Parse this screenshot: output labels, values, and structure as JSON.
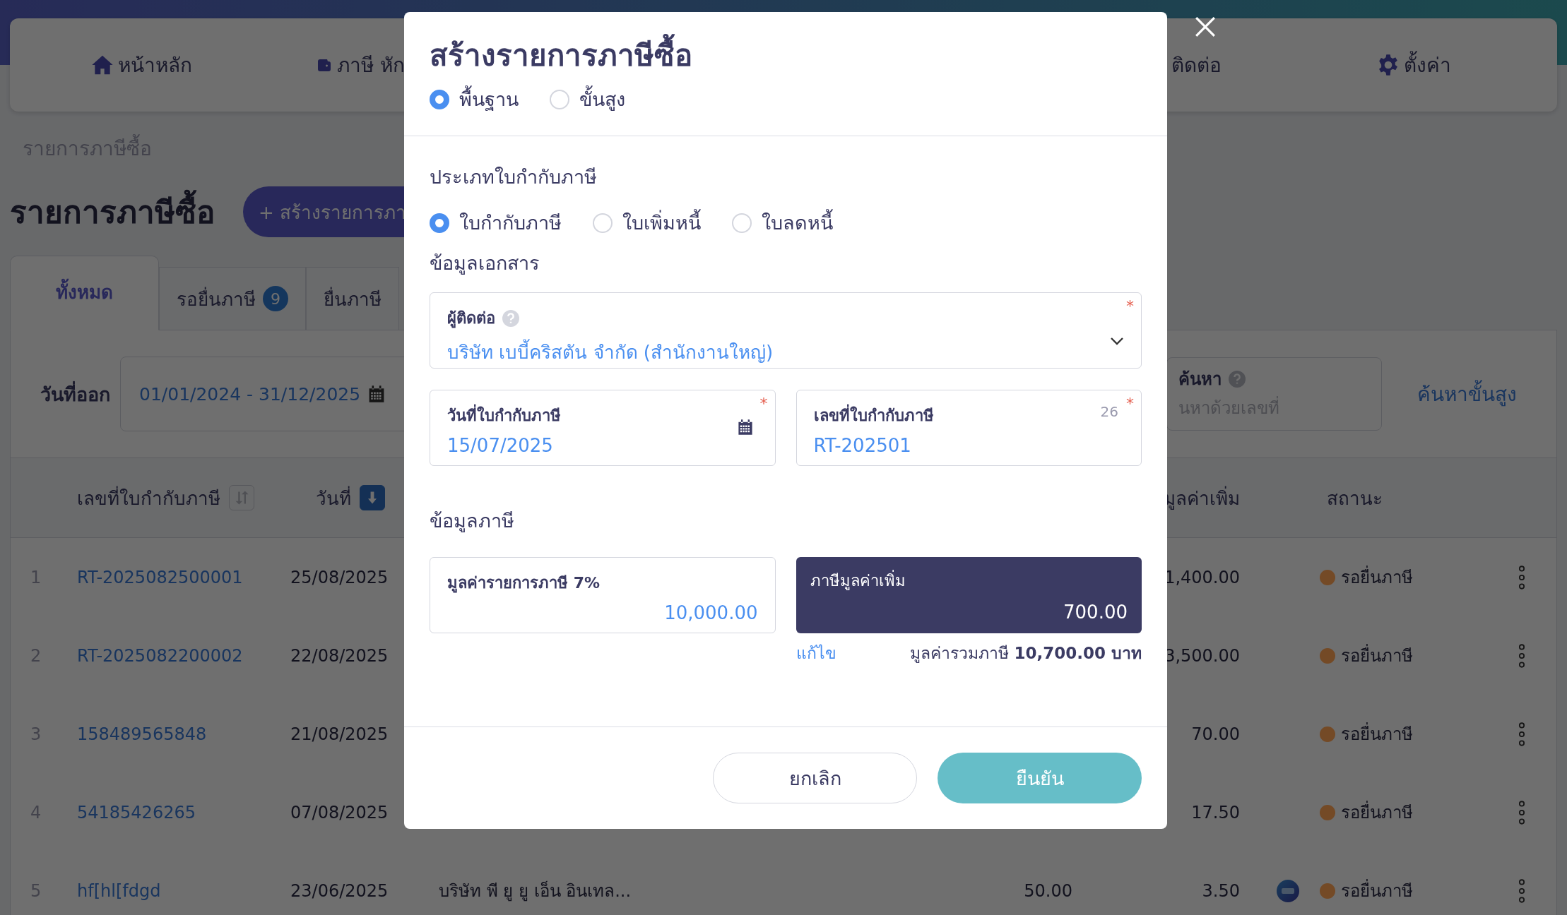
{
  "top_nav": {
    "items": [
      {
        "label": "หน้าหลัก"
      },
      {
        "label": "ภาษี หัก"
      },
      {
        "label": "ติดต่อ"
      },
      {
        "label": "ตั้งค่า"
      }
    ]
  },
  "breadcrumb": "รายการภาษีซื้อ",
  "page_title": "รายการภาษีซื้อ",
  "create_button": "+ สร้างรายการภา",
  "tabs": [
    {
      "label": "ทั้งหมด",
      "selected": true
    },
    {
      "label": "รอยื่นภาษี",
      "badge": "9",
      "selected": false
    },
    {
      "label": "ยื่นภาษี",
      "selected": false
    }
  ],
  "filters": {
    "date_label": "วันที่ออก",
    "date_range": "01/01/2024 - 31/12/2025",
    "search_label": "ค้นหา",
    "search_placeholder": "นหาด้วยเลขที่",
    "advanced_search": "ค้นหาขั้นสูง"
  },
  "table": {
    "header": {
      "doc_no": "เลขที่ใบกำกับภาษี",
      "doc_no_sort_active": false,
      "date": "วันที่",
      "date_sort_active": true,
      "vat": "มูลค่าเพิ่ม",
      "status": "สถานะ"
    },
    "rows": [
      {
        "index": "1",
        "doc_no": "RT-2025082500001",
        "date": "25/08/2025",
        "vat": "1,400.00",
        "tax_mark": false,
        "status": "รอยื่นภาษี",
        "color": "#744a26"
      },
      {
        "index": "2",
        "doc_no": "RT-2025082200002",
        "date": "22/08/2025",
        "vat": "3,500.00",
        "tax_mark": false,
        "status": "รอยื่นภาษี",
        "color": "#744a26"
      },
      {
        "index": "3",
        "doc_no": "158489565848",
        "date": "21/08/2025",
        "vat": "70.00",
        "tax_mark": false,
        "status": "รอยื่นภาษี",
        "color": "#744a26"
      },
      {
        "index": "4",
        "doc_no": "54185426265",
        "date": "07/08/2025",
        "vat": "17.50",
        "tax_mark": false,
        "status": "รอยื่นภาษี",
        "color": "#744a26"
      },
      {
        "index": "5",
        "doc_no": "hf[hl[fdgd",
        "date": "23/06/2025",
        "contact": "บริษัท พี ยู ยู เอ็น อินเทล...",
        "amount": "50.00",
        "vat": "3.50",
        "tax_mark": true,
        "status": "รอยื่นภาษี",
        "color": "#744a26"
      }
    ]
  },
  "modal": {
    "title": "สร้างรายการภาษีซื้อ",
    "modes": [
      {
        "label": "พื้นฐาน",
        "selected": true
      },
      {
        "label": "ขั้นสูง",
        "selected": false
      }
    ],
    "doc_type_label": "ประเภทใบกำกับภาษี",
    "doc_types": [
      {
        "label": "ใบกำกับภาษี",
        "selected": true
      },
      {
        "label": "ใบเพิ่มหนี้",
        "selected": false
      },
      {
        "label": "ใบลดหนี้",
        "selected": false
      }
    ],
    "doc_section": "ข้อมูลเอกสาร",
    "contact": {
      "label": "ผู้ติดต่อ",
      "value": "บริษัท เบบี้คริสตัน จำกัด (สำนักงานใหญ่)",
      "required_mark": "*"
    },
    "date": {
      "label": "วันที่ใบกำกับภาษี",
      "value": "15/07/2025",
      "required_mark": "*"
    },
    "number": {
      "label": "เลขที่ใบกำกับภาษี",
      "value": "RT-202501",
      "counter": "26",
      "required_mark": "*"
    },
    "tax_section": "ข้อมูลภาษี",
    "base": {
      "label": "มูลค่ารายการภาษี 7%",
      "value": "10,000.00"
    },
    "vat": {
      "label": "ภาษีมูลค่าเพิ่ม",
      "value": "700.00"
    },
    "edit_link": "แก้ไข",
    "total": "มูลค่ารวมภาษี **10,700.00 บาท**",
    "cancel": "ยกเลิก",
    "confirm": "ยืนยัน"
  }
}
